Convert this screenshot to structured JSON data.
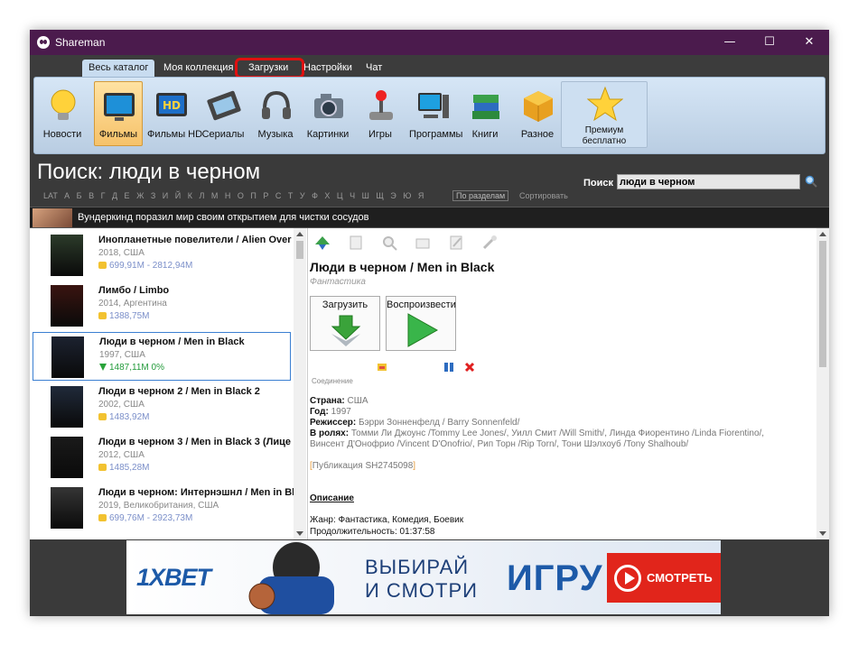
{
  "window": {
    "title": "Shareman",
    "min_glyph": "—",
    "max_glyph": "☐",
    "close_glyph": "✕"
  },
  "menu": {
    "tabs": [
      "Весь каталог",
      "Моя коллекция",
      "Загрузки",
      "Настройки",
      "Чат"
    ],
    "active": "Весь каталог",
    "highlighted": "Загрузки"
  },
  "categories": {
    "items": [
      {
        "label": "Новости",
        "icon": "lightbulb-icon"
      },
      {
        "label": "Фильмы",
        "icon": "tv-icon"
      },
      {
        "label": "Фильмы HD",
        "icon": "hd-monitor-icon"
      },
      {
        "label": "Сериалы",
        "icon": "film-reel-icon"
      },
      {
        "label": "Музыка",
        "icon": "headphones-icon"
      },
      {
        "label": "Картинки",
        "icon": "camera-icon"
      },
      {
        "label": "Игры",
        "icon": "joystick-icon"
      },
      {
        "label": "Программы",
        "icon": "computer-icon"
      },
      {
        "label": "Книги",
        "icon": "books-icon"
      },
      {
        "label": "Разное",
        "icon": "box-icon"
      }
    ],
    "active": "Фильмы",
    "premium": {
      "line1": "Премиум",
      "line2": "бесплатно",
      "icon": "star-icon"
    }
  },
  "search": {
    "heading": "Поиск: люди в черном",
    "alphabet": "LAT А Б В Г Д Е Ж З И Й К Л М Н О П Р С Т У Ф Х Ц Ч Ш Щ Э Ю Я",
    "by_sections": "По разделам",
    "sort": "Сортировать",
    "label": "Поиск",
    "value": "люди в черном"
  },
  "news": {
    "text": "Вундеркинд поразил мир своим открытием для чистки сосудов"
  },
  "results": [
    {
      "title": "Инопланетные повелители / Alien Over",
      "meta": "2018, США",
      "size": "699,91М - 2812,94М",
      "poster": "#2c3b2a"
    },
    {
      "title": "Лимбо / Limbo",
      "meta": "2014, Аргентина",
      "size": "1388,75М",
      "poster": "#3a1410"
    },
    {
      "title": "Люди в черном / Men in Black",
      "meta": "1997, США",
      "size": "1487,11М 0%",
      "poster": "#1c2230"
    },
    {
      "title": "Люди в черном 2 / Men in Black 2",
      "meta": "2002, США",
      "size": "1483,92М",
      "poster": "#202a3a"
    },
    {
      "title": "Люди в черном 3 / Men in Black 3 (Лице",
      "meta": "2012, США",
      "size": "1485,28М",
      "poster": "#1a1a1a"
    },
    {
      "title": "Люди в черном: Интернэшнл / Men in Bl",
      "meta": "2019, Великобритания, США",
      "size": "699,76М - 2923,73М",
      "poster": "#353535"
    }
  ],
  "detail": {
    "title": "Люди в черном / Men in Black",
    "genre": "Фантастика",
    "download_label": "Загрузить",
    "play_label": "Воспроизвести",
    "connection_label": "Соединение",
    "country_key": "Страна:",
    "country": "США",
    "year_key": "Год:",
    "year": "1997",
    "director_key": "Режиссер:",
    "director": "Бэрри Зонненфелд / Barry Sonnenfeld/",
    "cast_key": "В ролях:",
    "cast_1": "Томми Ли Джоунс /Tommy Lee Jones/, Уилл Смит /Will Smith/, Линда Фиорентино /Linda Fiorentino/,",
    "cast_2": "Винсент Д'Онофрио /Vincent D'Onofrio/, Рип Торн /Rip Torn/, Тони Шэлхоуб /Tony Shalhoub/",
    "pub_open": "[",
    "publication": "Публикация SH2745098",
    "pub_close": "]",
    "description_heading": "Описание",
    "genre_line": "Жанр: Фантастика, Комедия, Боевик",
    "duration_line": "Продолжительность: 01:37:58"
  },
  "ad": {
    "brand": "1XBET",
    "line1": "ВЫБИРАЙ",
    "line2": "И СМОТРИ",
    "big": "ИГРУ",
    "cta": "СМОТРЕТЬ"
  },
  "colors": {
    "titlebar": "#4b1b4d",
    "highlight": "#e01010",
    "accent": "#3b7fd1",
    "ad_red": "#e1251b"
  }
}
